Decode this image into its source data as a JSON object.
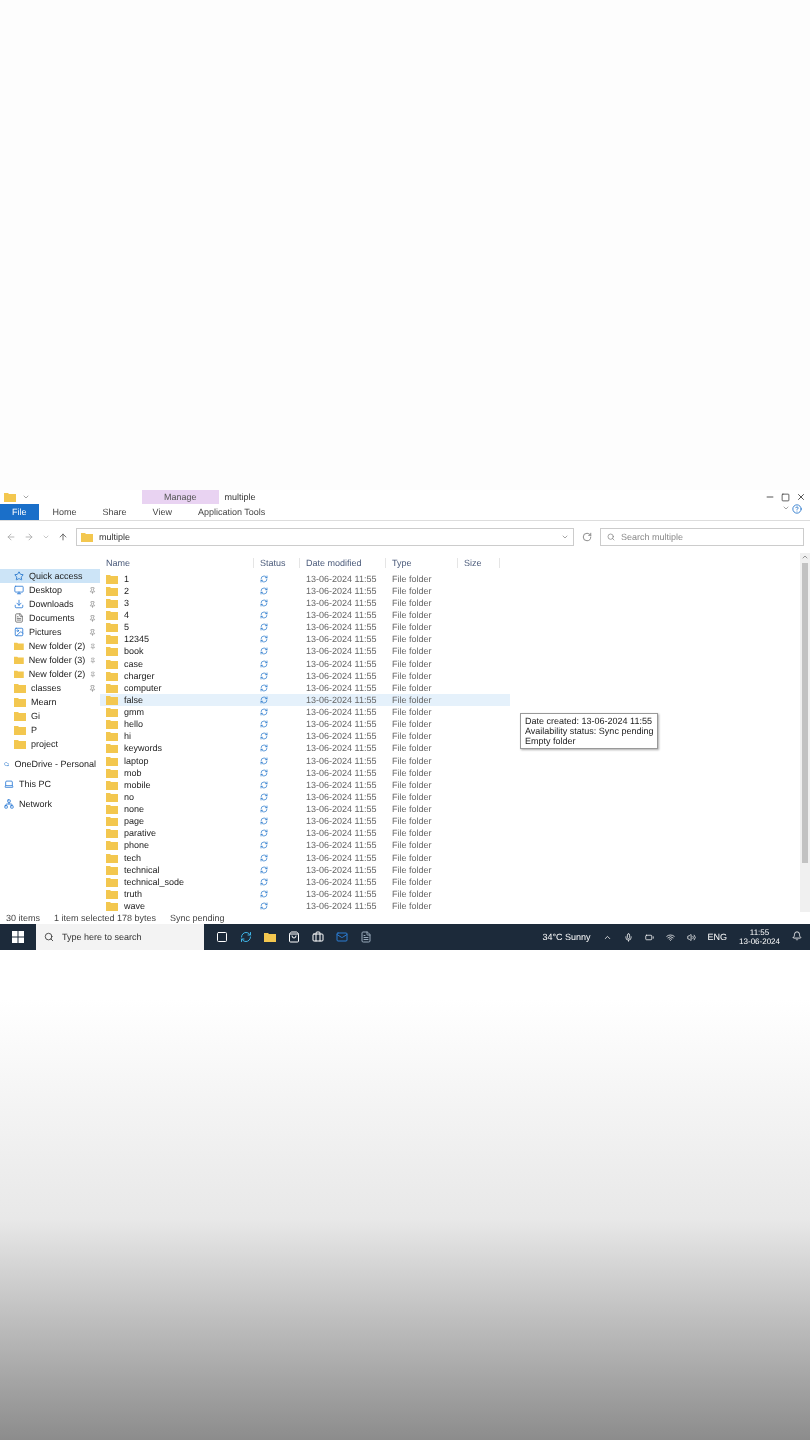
{
  "window": {
    "title": "multiple",
    "context_tab": "Manage"
  },
  "ribbon_tabs": [
    {
      "label": "File",
      "selected": true
    },
    {
      "label": "Home",
      "selected": false
    },
    {
      "label": "Share",
      "selected": false
    },
    {
      "label": "View",
      "selected": false
    },
    {
      "label": "Application Tools",
      "selected": false
    }
  ],
  "address": {
    "path": "multiple",
    "search_placeholder": "Search multiple"
  },
  "nav": [
    {
      "label": "Quick access",
      "kind": "star",
      "pinned": false,
      "selected": true
    },
    {
      "label": "Desktop",
      "kind": "desktop",
      "pinned": true,
      "selected": false
    },
    {
      "label": "Downloads",
      "kind": "download",
      "pinned": true,
      "selected": false
    },
    {
      "label": "Documents",
      "kind": "document",
      "pinned": true,
      "selected": false
    },
    {
      "label": "Pictures",
      "kind": "picture",
      "pinned": true,
      "selected": false
    },
    {
      "label": "New folder (2)",
      "kind": "folder",
      "pinned": true,
      "selected": false
    },
    {
      "label": "New folder (3)",
      "kind": "folder",
      "pinned": true,
      "selected": false
    },
    {
      "label": "New folder (2)",
      "kind": "folder",
      "pinned": true,
      "selected": false
    },
    {
      "label": "classes",
      "kind": "folder",
      "pinned": true,
      "selected": false
    },
    {
      "label": "Mearn",
      "kind": "folder",
      "pinned": false,
      "selected": false
    },
    {
      "label": "Gi",
      "kind": "folder",
      "pinned": false,
      "selected": false
    },
    {
      "label": "P",
      "kind": "folder",
      "pinned": false,
      "selected": false
    },
    {
      "label": "project",
      "kind": "folder",
      "pinned": false,
      "selected": false
    },
    {
      "label": "OneDrive - Personal",
      "kind": "cloud",
      "pinned": false,
      "selected": false
    },
    {
      "label": "This PC",
      "kind": "pc",
      "pinned": false,
      "selected": false
    },
    {
      "label": "Network",
      "kind": "network",
      "pinned": false,
      "selected": false
    }
  ],
  "columns": [
    "Name",
    "Status",
    "Date modified",
    "Type",
    "Size"
  ],
  "rows": [
    {
      "name": "1",
      "date": "13-06-2024 11:55",
      "type": "File folder",
      "selected": false
    },
    {
      "name": "2",
      "date": "13-06-2024 11:55",
      "type": "File folder",
      "selected": false
    },
    {
      "name": "3",
      "date": "13-06-2024 11:55",
      "type": "File folder",
      "selected": false
    },
    {
      "name": "4",
      "date": "13-06-2024 11:55",
      "type": "File folder",
      "selected": false
    },
    {
      "name": "5",
      "date": "13-06-2024 11:55",
      "type": "File folder",
      "selected": false
    },
    {
      "name": "12345",
      "date": "13-06-2024 11:55",
      "type": "File folder",
      "selected": false
    },
    {
      "name": "book",
      "date": "13-06-2024 11:55",
      "type": "File folder",
      "selected": false
    },
    {
      "name": "case",
      "date": "13-06-2024 11:55",
      "type": "File folder",
      "selected": false
    },
    {
      "name": "charger",
      "date": "13-06-2024 11:55",
      "type": "File folder",
      "selected": false
    },
    {
      "name": "computer",
      "date": "13-06-2024 11:55",
      "type": "File folder",
      "selected": false
    },
    {
      "name": "false",
      "date": "13-06-2024 11:55",
      "type": "File folder",
      "selected": true
    },
    {
      "name": "gmm",
      "date": "13-06-2024 11:55",
      "type": "File folder",
      "selected": false
    },
    {
      "name": "hello",
      "date": "13-06-2024 11:55",
      "type": "File folder",
      "selected": false
    },
    {
      "name": "hi",
      "date": "13-06-2024 11:55",
      "type": "File folder",
      "selected": false
    },
    {
      "name": "keywords",
      "date": "13-06-2024 11:55",
      "type": "File folder",
      "selected": false
    },
    {
      "name": "laptop",
      "date": "13-06-2024 11:55",
      "type": "File folder",
      "selected": false
    },
    {
      "name": "mob",
      "date": "13-06-2024 11:55",
      "type": "File folder",
      "selected": false
    },
    {
      "name": "mobile",
      "date": "13-06-2024 11:55",
      "type": "File folder",
      "selected": false
    },
    {
      "name": "no",
      "date": "13-06-2024 11:55",
      "type": "File folder",
      "selected": false
    },
    {
      "name": "none",
      "date": "13-06-2024 11:55",
      "type": "File folder",
      "selected": false
    },
    {
      "name": "page",
      "date": "13-06-2024 11:55",
      "type": "File folder",
      "selected": false
    },
    {
      "name": "parative",
      "date": "13-06-2024 11:55",
      "type": "File folder",
      "selected": false
    },
    {
      "name": "phone",
      "date": "13-06-2024 11:55",
      "type": "File folder",
      "selected": false
    },
    {
      "name": "tech",
      "date": "13-06-2024 11:55",
      "type": "File folder",
      "selected": false
    },
    {
      "name": "technical",
      "date": "13-06-2024 11:55",
      "type": "File folder",
      "selected": false
    },
    {
      "name": "technical_sode",
      "date": "13-06-2024 11:55",
      "type": "File folder",
      "selected": false
    },
    {
      "name": "truth",
      "date": "13-06-2024 11:55",
      "type": "File folder",
      "selected": false
    },
    {
      "name": "wave",
      "date": "13-06-2024 11:55",
      "type": "File folder",
      "selected": false
    }
  ],
  "tooltip": [
    "Date created: 13-06-2024 11:55",
    "Availability status: Sync pending",
    "Empty folder"
  ],
  "status_bar": [
    "30 items",
    "1 item selected 178 bytes",
    "Sync pending"
  ],
  "taskbar": {
    "search_placeholder": "Type here to search",
    "weather": "34°C Sunny",
    "language": "ENG",
    "time": "11:55",
    "date": "13-06-2024"
  }
}
